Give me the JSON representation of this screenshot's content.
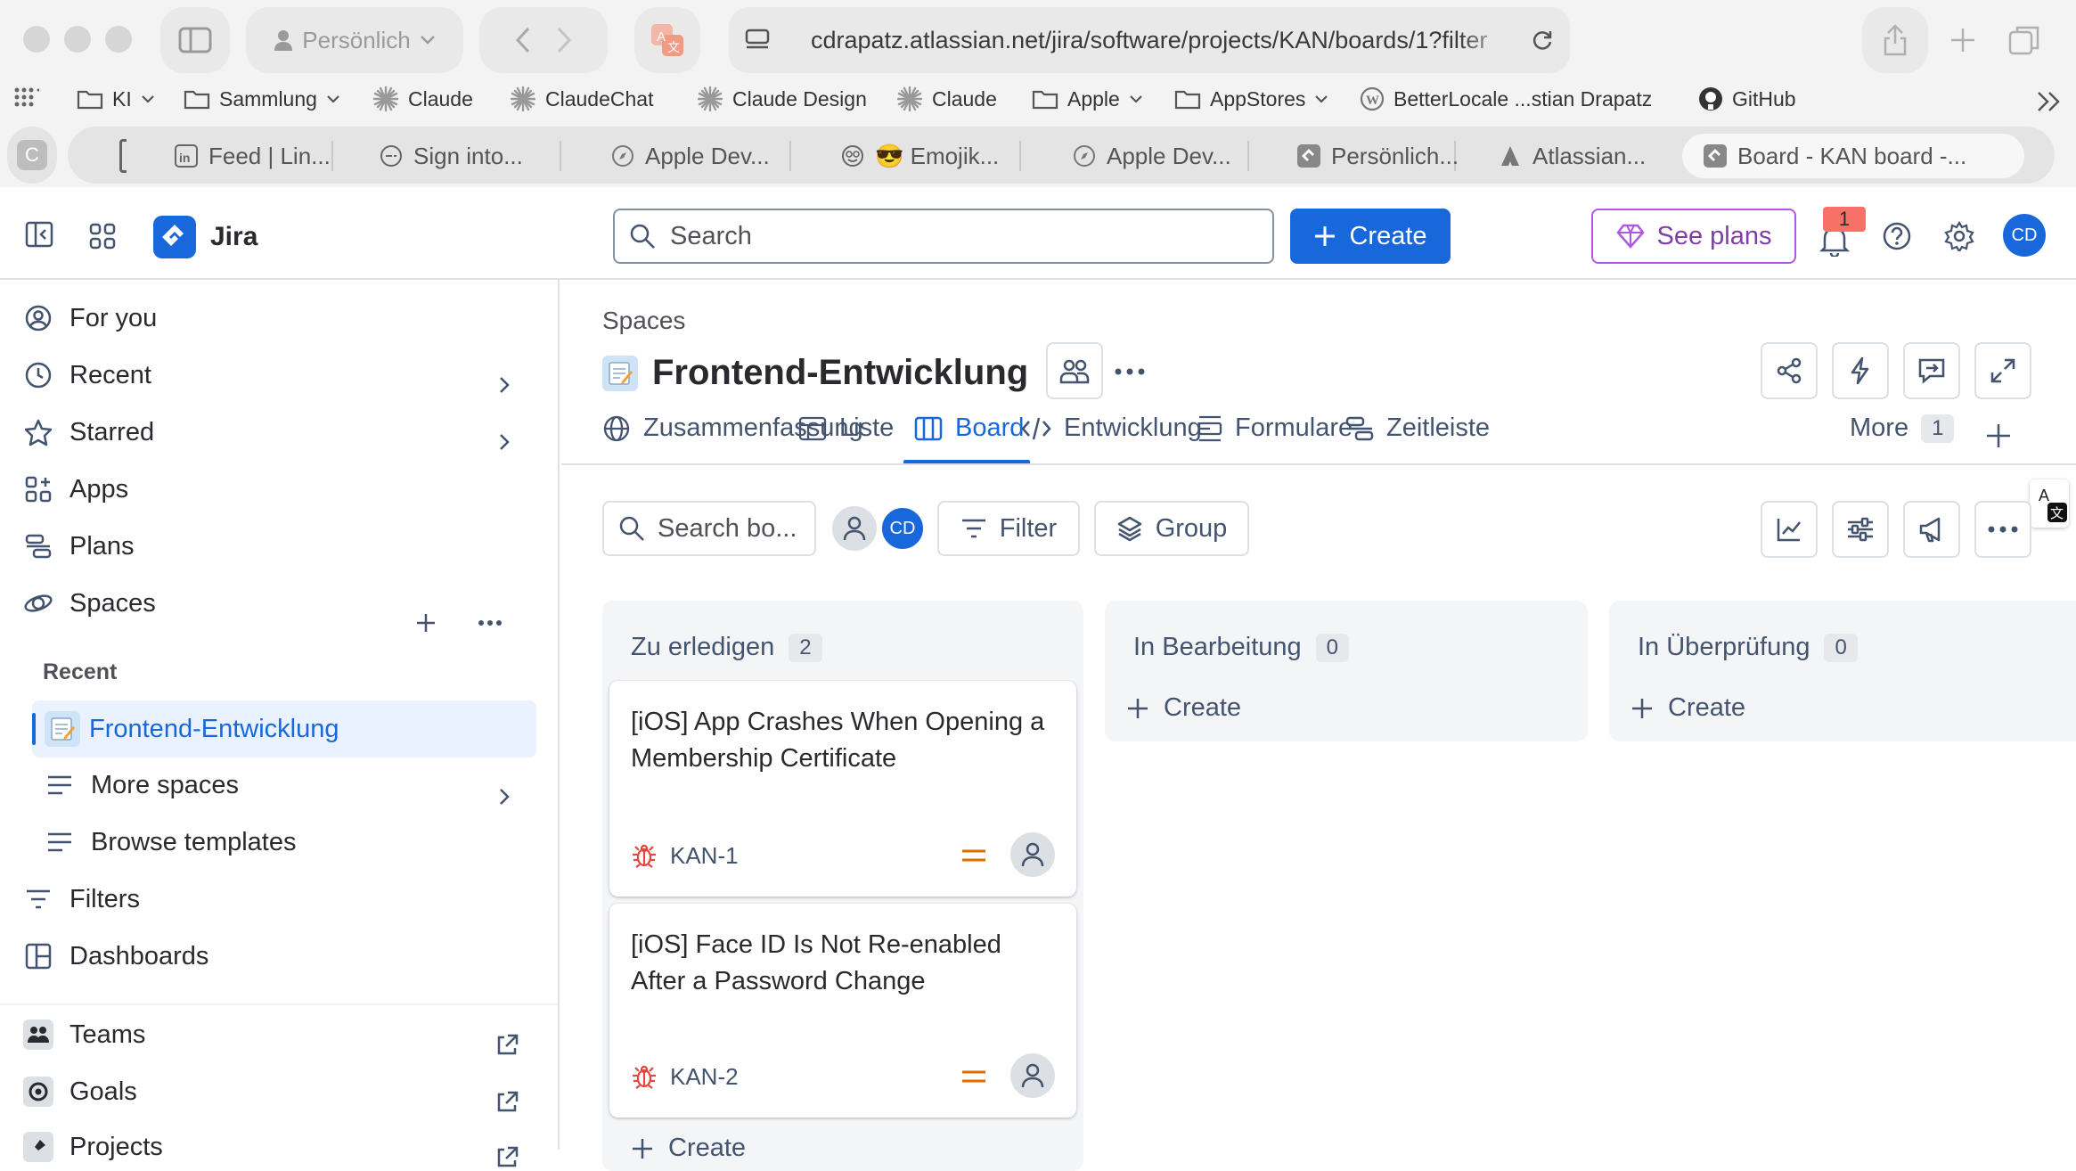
{
  "browser": {
    "profile": "Persönlich",
    "url": "cdrapatz.atlassian.net/jira/software/projects/KAN/boards/1?filter",
    "bookmarks": [
      {
        "label": "KI",
        "icon": "folder-icon",
        "menu": true
      },
      {
        "label": "Sammlung",
        "icon": "folder-icon",
        "menu": true
      },
      {
        "label": "Claude",
        "icon": "claude-icon"
      },
      {
        "label": "ClaudeChat",
        "icon": "claude-icon"
      },
      {
        "label": "Claude Design",
        "icon": "claude-icon"
      },
      {
        "label": "Claude",
        "icon": "claude-icon"
      },
      {
        "label": "Apple",
        "icon": "folder-icon",
        "menu": true
      },
      {
        "label": "AppStores",
        "icon": "folder-icon",
        "menu": true
      },
      {
        "label": "BetterLocale ...stian Drapatz",
        "icon": "wordpress-icon"
      },
      {
        "label": "GitHub",
        "icon": "github-icon"
      }
    ],
    "tabs": [
      {
        "label": "Feed | Lin...",
        "icon": "linkedin-icon"
      },
      {
        "label": "Sign into...",
        "icon": "signin-icon"
      },
      {
        "label": "Apple Dev...",
        "icon": "safari-icon"
      },
      {
        "label": "😎 Emojik...",
        "icon": "emoji-icon"
      },
      {
        "label": "Apple Dev...",
        "icon": "safari-icon"
      },
      {
        "label": "Persönlich...",
        "icon": "jira-icon"
      },
      {
        "label": "Atlassian...",
        "icon": "atlassian-icon"
      },
      {
        "label": "Board - KAN board -...",
        "icon": "jira-icon",
        "active": true
      }
    ],
    "pinned_tab_letter": "C"
  },
  "topbar": {
    "app_name": "Jira",
    "search_placeholder": "Search",
    "create_label": "Create",
    "see_plans_label": "See plans",
    "notification_count": "1",
    "avatar_initials": "CD"
  },
  "sidebar": {
    "items": [
      {
        "label": "For you",
        "icon": "person-circle-icon"
      },
      {
        "label": "Recent",
        "icon": "clock-icon",
        "chevron": true
      },
      {
        "label": "Starred",
        "icon": "star-icon",
        "chevron": true
      },
      {
        "label": "Apps",
        "icon": "apps-icon"
      },
      {
        "label": "Plans",
        "icon": "plans-icon"
      },
      {
        "label": "Spaces",
        "icon": "spaces-icon"
      }
    ],
    "recent_heading": "Recent",
    "current_space": "Frontend-Entwicklung",
    "more_spaces": "More spaces",
    "browse_templates": "Browse templates",
    "filters": "Filters",
    "dashboards": "Dashboards",
    "teams": "Teams",
    "goals": "Goals",
    "projects": "Projects"
  },
  "project": {
    "breadcrumb": "Spaces",
    "name": "Frontend-Entwicklung",
    "tabs": [
      {
        "label": "Zusammenfassung",
        "icon": "globe-icon"
      },
      {
        "label": "Liste",
        "icon": "list-table-icon"
      },
      {
        "label": "Board",
        "icon": "board-icon",
        "active": true
      },
      {
        "label": "Entwicklung",
        "icon": "code-icon"
      },
      {
        "label": "Formulare",
        "icon": "forms-icon"
      },
      {
        "label": "Zeitleiste",
        "icon": "timeline-icon"
      }
    ],
    "more_label": "More",
    "more_count": "1"
  },
  "board": {
    "search_placeholder": "Search bo...",
    "avatar_initials": "CD",
    "filter_label": "Filter",
    "group_label": "Group",
    "columns": [
      {
        "title": "Zu erledigen",
        "count": "2",
        "cards": [
          {
            "title": "[iOS] App Crashes When Opening a Membership Certificate",
            "key": "KAN-1"
          },
          {
            "title": "[iOS] Face ID Is Not Re-enabled After a Password Change",
            "key": "KAN-2"
          }
        ],
        "create_label": "Create"
      },
      {
        "title": "In Bearbeitung",
        "count": "0",
        "cards": [],
        "create_label": "Create"
      },
      {
        "title": "In Überprüfung",
        "count": "0",
        "cards": [],
        "create_label": "Create"
      }
    ]
  },
  "colors": {
    "primary": "#1868db",
    "selected_bg": "#e9f2fe",
    "bug": "#e2483d",
    "priority_medium": "#e06c00",
    "see_plans_border": "#af59e1"
  }
}
